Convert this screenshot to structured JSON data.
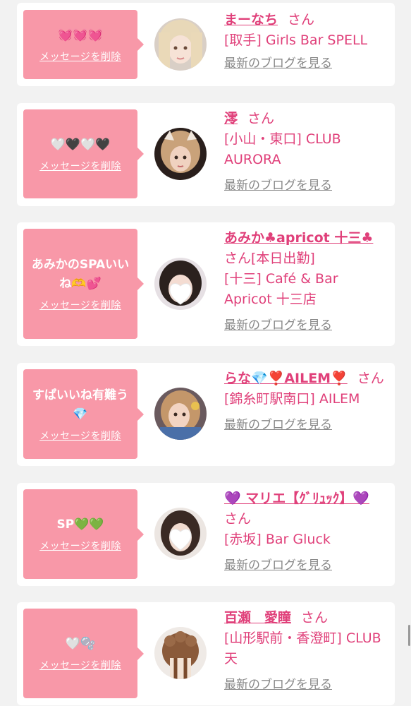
{
  "cards": [
    {
      "message": "💓💓💓",
      "delete_label": "メッセージを削除",
      "name": "まーなち",
      "honorific": "さん",
      "shop": "[取手] Girls Bar SPELL",
      "blog_label": "最新のブログを見る"
    },
    {
      "message": "🤍🖤🤍🖤",
      "delete_label": "メッセージを削除",
      "name": "澪",
      "honorific": "さん",
      "shop": "[小山・東口] CLUB AURORA",
      "blog_label": "最新のブログを見る"
    },
    {
      "message": "あみかのSPAいいね🫶💕",
      "delete_label": "メッセージを削除",
      "name": "あみか♣apricot 十三♣",
      "honorific": "さん[本日出勤]",
      "shop": "[十三] Café & Bar Apricot 十三店",
      "blog_label": "最新のブログを見る"
    },
    {
      "message": "すぱいいね有難う💎",
      "delete_label": "メッセージを削除",
      "name": "らな💎❣️AILEM❣️",
      "honorific": "さん",
      "shop": "[錦糸町駅南口] AILEM",
      "blog_label": "最新のブログを見る"
    },
    {
      "message": "SP💚💚",
      "delete_label": "メッセージを削除",
      "name": "💜 マリエ【ｸﾞﾘｭｯｸ】💜",
      "honorific": "さん",
      "shop": "[赤坂] Bar Gluck",
      "blog_label": "最新のブログを見る"
    },
    {
      "message": "🤍🫧",
      "delete_label": "メッセージを削除",
      "name": "百瀬　愛瞳",
      "honorific": "さん",
      "shop": "[山形駅前・香澄町] CLUB 天",
      "blog_label": "最新のブログを見る"
    }
  ]
}
